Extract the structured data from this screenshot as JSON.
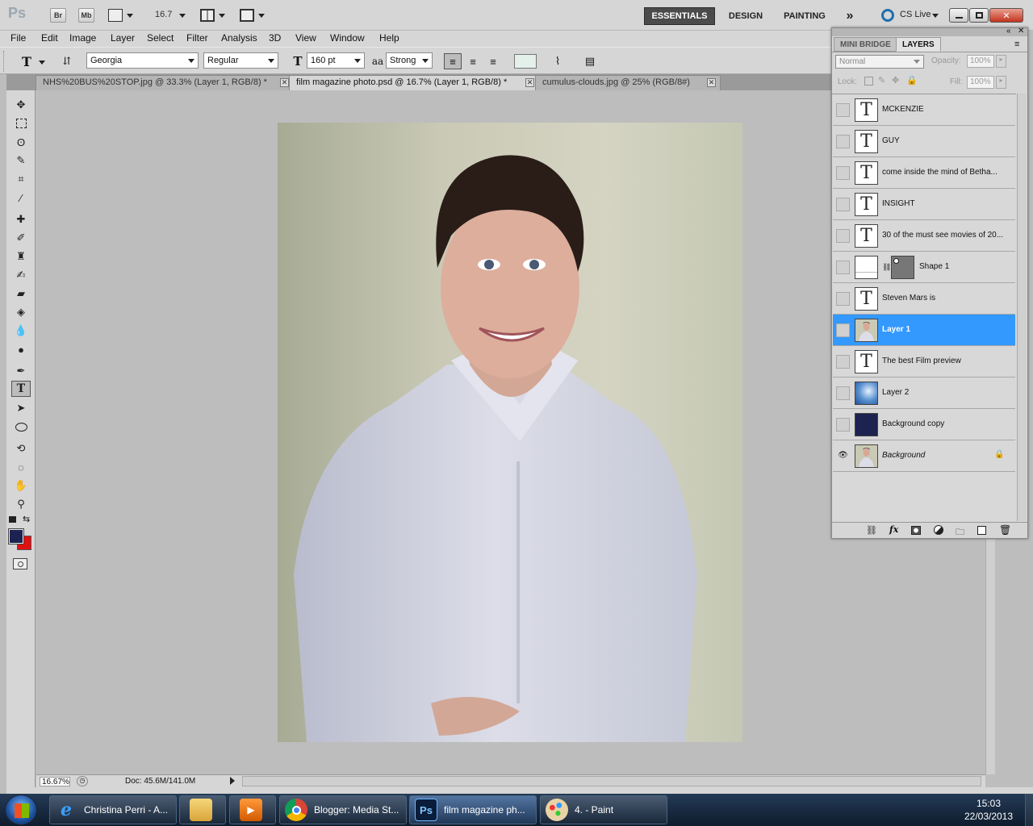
{
  "app": {
    "logo": "Ps",
    "bridge_btn": "Br",
    "minibridge_btn": "Mb",
    "zoom_value": "16.7",
    "workspaces": [
      "ESSENTIALS",
      "DESIGN",
      "PAINTING"
    ],
    "more_workspaces": "»",
    "cs_live": "CS Live"
  },
  "menu": [
    "File",
    "Edit",
    "Image",
    "Layer",
    "Select",
    "Filter",
    "Analysis",
    "3D",
    "View",
    "Window",
    "Help"
  ],
  "options": {
    "tool_glyph": "T",
    "font_family": "Georgia",
    "font_style": "Regular",
    "font_size": "160 pt",
    "antialias_glyph": "aa",
    "antialias": "Strong",
    "text_color": "#e3f1ea"
  },
  "tabs": [
    {
      "label": "NHS%20BUS%20STOP.jpg @ 33.3% (Layer 1, RGB/8) *"
    },
    {
      "label": "film magazine photo.psd @ 16.7% (Layer 1, RGB/8) *"
    },
    {
      "label": "cumulus-clouds.jpg @ 25% (RGB/8#)"
    }
  ],
  "status": {
    "zoom": "16.67%",
    "doc": "Doc: 45.6M/141.0M"
  },
  "colors": {
    "foreground": "#1c2350",
    "background": "#e01010",
    "selection": "#3399ff"
  },
  "panel": {
    "tab_minibridge": "MINI BRIDGE",
    "tab_layers": "LAYERS",
    "blend_mode": "Normal",
    "opacity_label": "Opacity:",
    "opacity": "100%",
    "lock_label": "Lock:",
    "fill_label": "Fill:",
    "fill": "100%",
    "layers": [
      {
        "name": "MCKENZIE",
        "kind": "text",
        "visible": false,
        "selected": false
      },
      {
        "name": "GUY",
        "kind": "text",
        "visible": false,
        "selected": false
      },
      {
        "name": "come inside the mind of Betha...",
        "kind": "text",
        "visible": false,
        "selected": false
      },
      {
        "name": "INSIGHT",
        "kind": "text",
        "visible": false,
        "selected": false
      },
      {
        "name": "30 of the must see movies of 20...",
        "kind": "text",
        "visible": false,
        "selected": false
      },
      {
        "name": "Shape 1",
        "kind": "shape",
        "visible": false,
        "selected": false
      },
      {
        "name": "Steven Mars is",
        "kind": "text",
        "visible": false,
        "selected": false
      },
      {
        "name": "Layer 1",
        "kind": "photo",
        "visible": false,
        "selected": true
      },
      {
        "name": "The best Film preview",
        "kind": "text",
        "visible": false,
        "selected": false
      },
      {
        "name": "Layer 2",
        "kind": "clouds",
        "visible": false,
        "selected": false
      },
      {
        "name": "Background copy",
        "kind": "fill",
        "visible": false,
        "selected": false
      },
      {
        "name": "Background",
        "kind": "photo",
        "visible": true,
        "selected": false,
        "locked": true
      }
    ]
  },
  "taskbar": {
    "items": [
      {
        "label": "Christina Perri - A...",
        "icon": "ie-icon"
      },
      {
        "label": "",
        "icon": "explorer-icon"
      },
      {
        "label": "",
        "icon": "media-player-icon"
      },
      {
        "label": "Blogger: Media St...",
        "icon": "chrome-icon"
      },
      {
        "label": "film magazine ph...",
        "icon": "photoshop-icon"
      },
      {
        "label": "4. - Paint",
        "icon": "paint-icon"
      }
    ],
    "time": "15:03",
    "date": "22/03/2013"
  }
}
